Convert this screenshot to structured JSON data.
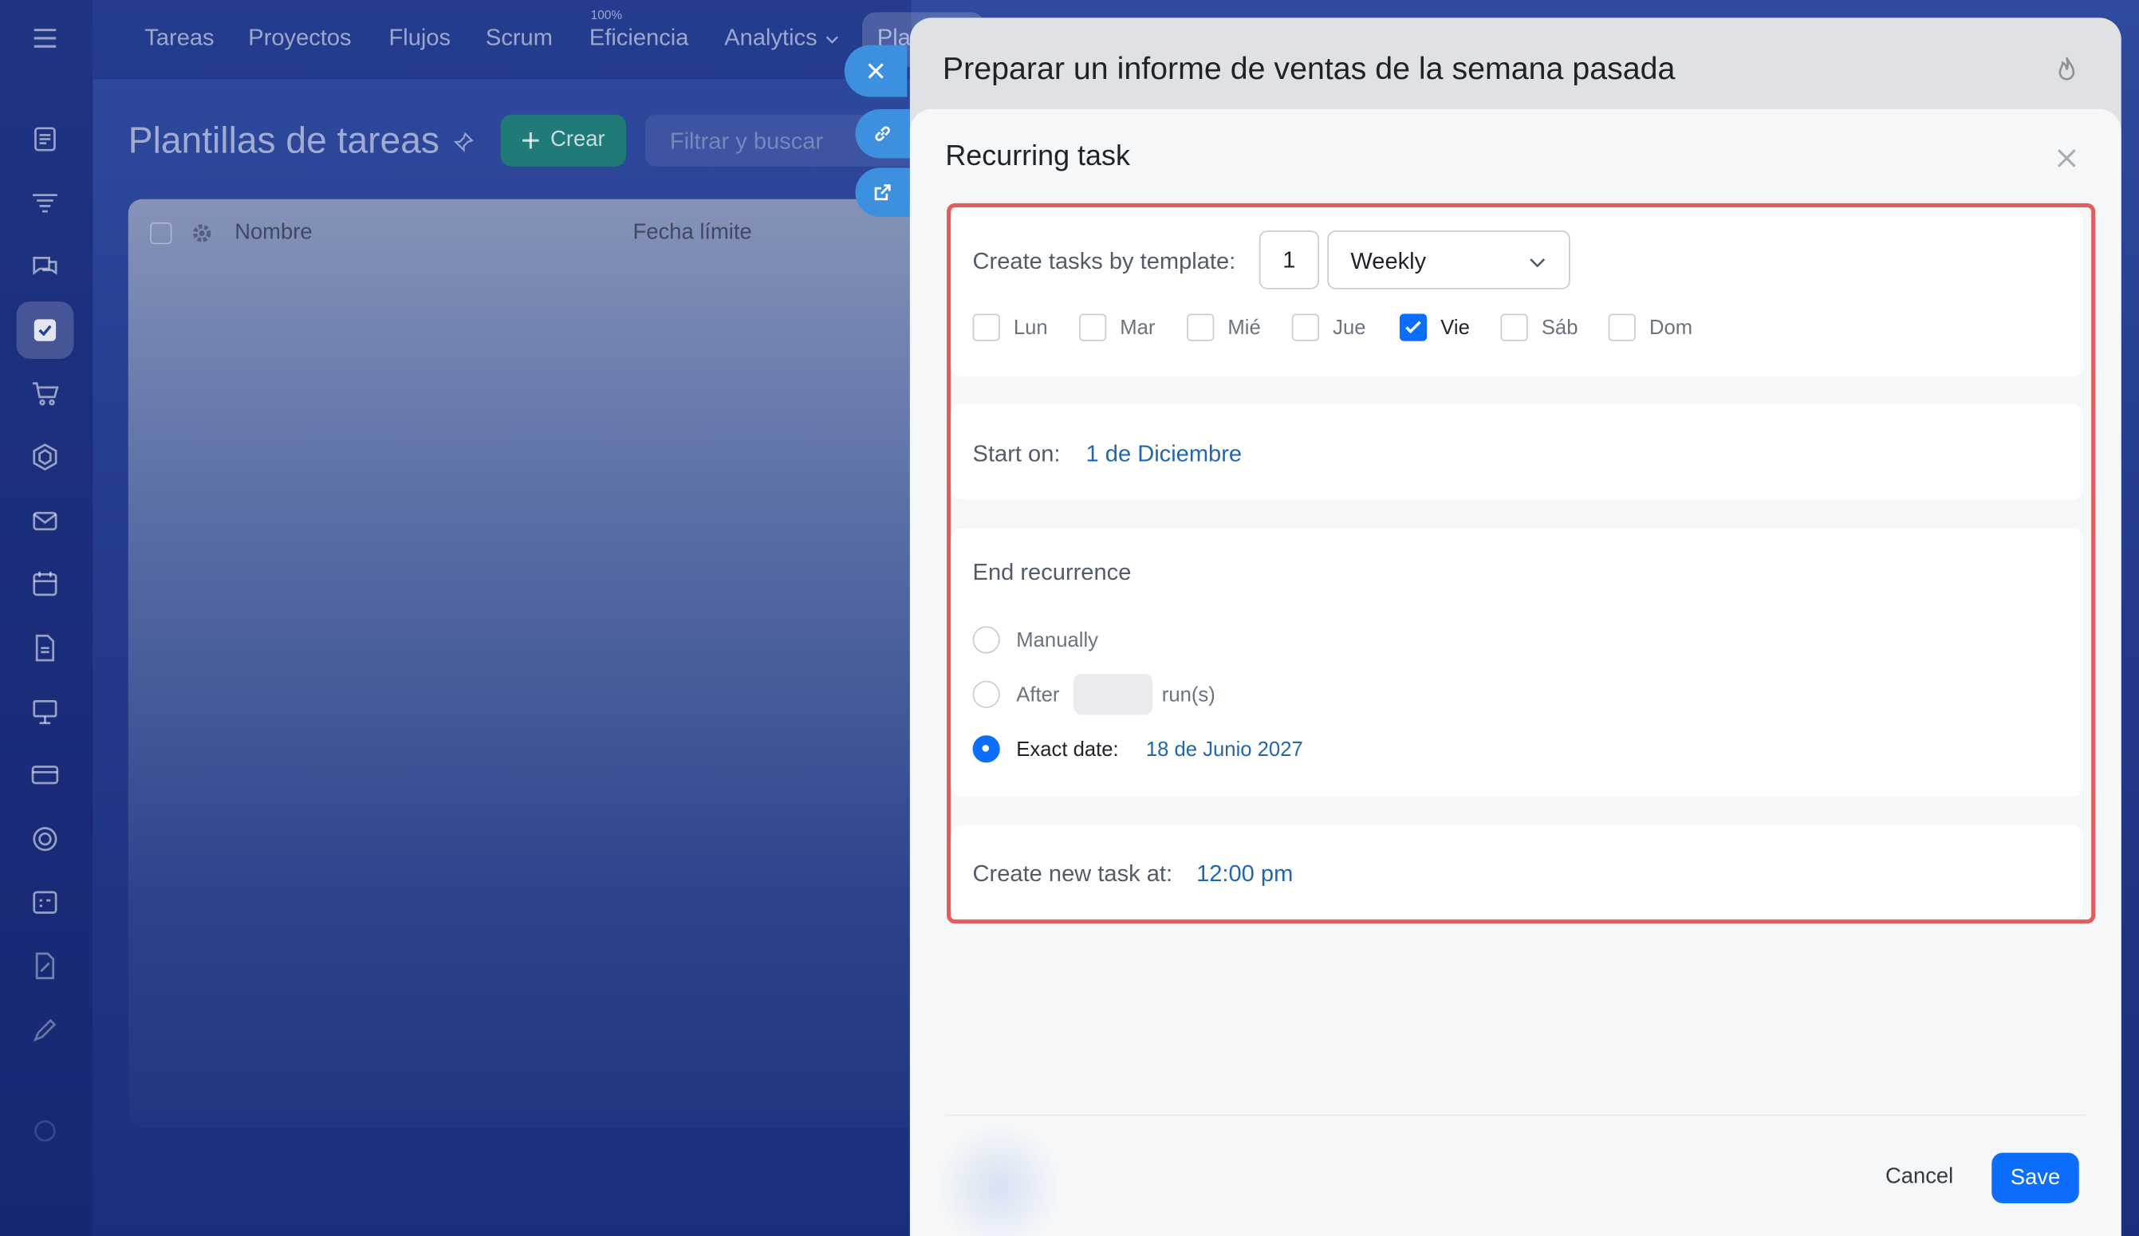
{
  "topnav": {
    "items": [
      "Tareas",
      "Proyectos",
      "Flujos",
      "Scrum",
      "Eficiencia",
      "Analytics"
    ],
    "efficiency_badge": "100%",
    "partial_tab": "Pla"
  },
  "page": {
    "title": "Plantillas de tareas",
    "create_label": "Crear",
    "search_placeholder": "Filtrar y buscar",
    "columns": [
      "Nombre",
      "Fecha límite"
    ]
  },
  "slider": {
    "task_title": "Preparar un informe de ventas de la semana pasada"
  },
  "dialog": {
    "title": "Recurring task",
    "repeat": {
      "label": "Create tasks by template:",
      "interval": "1",
      "period": "Weekly",
      "days": [
        {
          "label": "Lun",
          "checked": false
        },
        {
          "label": "Mar",
          "checked": false
        },
        {
          "label": "Mié",
          "checked": false
        },
        {
          "label": "Jue",
          "checked": false
        },
        {
          "label": "Vie",
          "checked": true
        },
        {
          "label": "Sáb",
          "checked": false
        },
        {
          "label": "Dom",
          "checked": false
        }
      ]
    },
    "start": {
      "label": "Start on:",
      "value": "1 de Diciembre"
    },
    "end": {
      "heading": "End recurrence",
      "manually_label": "Manually",
      "after_label": "After",
      "runs_label": "run(s)",
      "exact_label": "Exact date:",
      "exact_value": "18 de Junio 2027",
      "selected": "exact"
    },
    "time": {
      "label": "Create new task at:",
      "value": "12:00 pm"
    },
    "cancel_label": "Cancel",
    "save_label": "Save"
  },
  "colors": {
    "accent": "#0d6efd",
    "link": "#2067b0",
    "highlight_frame": "#e45d5d"
  }
}
